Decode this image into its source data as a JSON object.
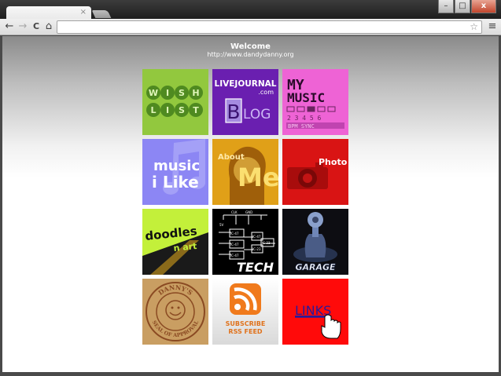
{
  "browser": {
    "tab_close": "×",
    "win_controls": {
      "minimize": "–",
      "maximize": "□",
      "close": "x"
    },
    "toolbar": {
      "back": "←",
      "forward": "→",
      "reload": "C",
      "home": "⌂",
      "star": "☆",
      "menu": "≡"
    },
    "address": ""
  },
  "page": {
    "welcome": "Welcome",
    "url": "http://www.dandydanny.org"
  },
  "tiles": {
    "wishlist": {
      "letters": [
        "W",
        "I",
        "S",
        "H",
        "L",
        "I",
        "S",
        "T"
      ]
    },
    "blog": {
      "line1": "LIVEJOURNAL",
      "line2": ".com",
      "big_letter": "B",
      "rest": "LOG"
    },
    "mymusic": {
      "line1": "MY",
      "line2": "MUSIC",
      "digits": "2 3 4 5 6",
      "caption": "BPM SYNC"
    },
    "musiclike": {
      "line1": "music",
      "line2": "i Like"
    },
    "aboutme": {
      "line1": "About",
      "line2": "Me"
    },
    "photo": {
      "label": "Photo"
    },
    "doodles": {
      "line1": "doodles",
      "line2": "n art"
    },
    "tech": {
      "label": "TECH",
      "chips": [
        "IC-47",
        "IC-47",
        "IC-23",
        "IC-47",
        "IC-47",
        "IC-23"
      ],
      "bus": [
        "CLK",
        "GND",
        "5V"
      ]
    },
    "garage": {
      "label": "GARAGE"
    },
    "seal": {
      "top": "DANNY'S",
      "bottom": "SEAL OF APPROVAL"
    },
    "rss": {
      "line1": "SUBSCRIBE",
      "line2": "RSS FEED"
    },
    "links": {
      "label": "LINKS"
    }
  },
  "colors": {
    "wishlist_bg": "#92c83e",
    "blog_bg": "#6a1fb0",
    "mymusic_bg": "#ee63d5",
    "musiclike_bg": "#8c86f4",
    "aboutme_bg": "#e0a018",
    "photo_bg": "#d91414",
    "doodles_bg": "#c3f03a",
    "garage_bg": "#0d0d12",
    "seal_bg": "#c99e62",
    "rss_accent": "#f07a1c",
    "links_bg": "#ff0a0a"
  }
}
